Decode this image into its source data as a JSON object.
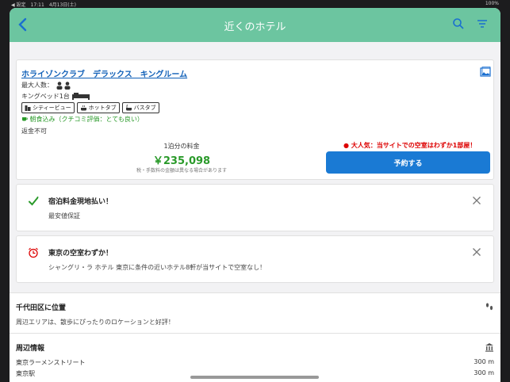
{
  "statusbar": {
    "left": "◀ 設定　17:11　4月13日(土)",
    "right": "100%"
  },
  "header": {
    "title": "近くのホテル"
  },
  "room": {
    "title": "ホライゾンクラブ　デラックス　キングルーム",
    "max_guests_label": "最大人数：",
    "bed": "キングベッド1台",
    "tags": [
      "シティービュー",
      "ホットタブ",
      "バスタブ"
    ],
    "breakfast": "朝食込み（クチコミ評価：とても良い）",
    "refund": "返金不可",
    "price_label": "1泊分の料金",
    "price": "￥235,098",
    "tax_note": "税・手数料の金額は異なる場合があります",
    "popular": "● 大人気：当サイトでの空室はわずか1部屋！",
    "reserve_label": "予約する"
  },
  "notices": [
    {
      "title": "宿泊料金現地払い！",
      "desc": "最安値保証"
    },
    {
      "title": "東京の空室わずか！",
      "desc": "シャングリ・ラ ホテル 東京に条件の近いホテル8軒が当サイトで空室なし！"
    }
  ],
  "location": {
    "heading": "千代田区に位置",
    "desc": "周辺エリアは、散歩にぴったりのロケーションと好評！"
  },
  "nearby": {
    "heading": "周辺情報",
    "items": [
      {
        "name": "東京ラーメンストリート",
        "dist": "300 m"
      },
      {
        "name": "東京駅",
        "dist": "300 m"
      }
    ]
  },
  "colors": {
    "header": "#6cc5a0",
    "accent": "#1a7ad4",
    "price": "#2a9a2a",
    "alert": "#dd0000"
  }
}
